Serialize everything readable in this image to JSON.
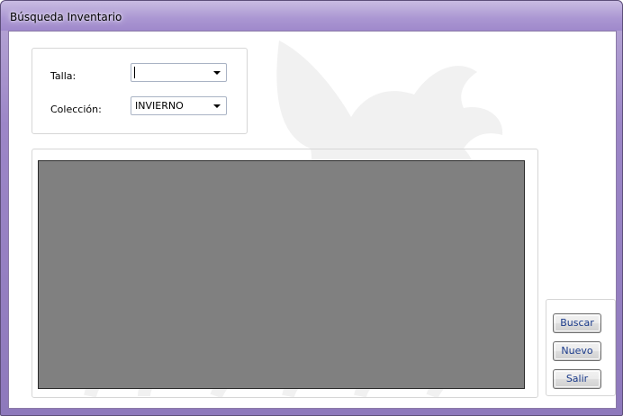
{
  "window": {
    "title": "Búsqueda Inventario"
  },
  "filters": {
    "talla_label": "Talla:",
    "talla_value": "",
    "coleccion_label": "Colección:",
    "coleccion_value": "INVIERNO"
  },
  "buttons": {
    "buscar": "Buscar",
    "nuevo": "Nuevo",
    "salir": "Salir"
  },
  "colors": {
    "title_bar": "#aa96d2",
    "grid_background": "#808080",
    "button_text": "#1a3a8a"
  },
  "icons": {
    "background_watermark": "winged-horse-logo"
  }
}
